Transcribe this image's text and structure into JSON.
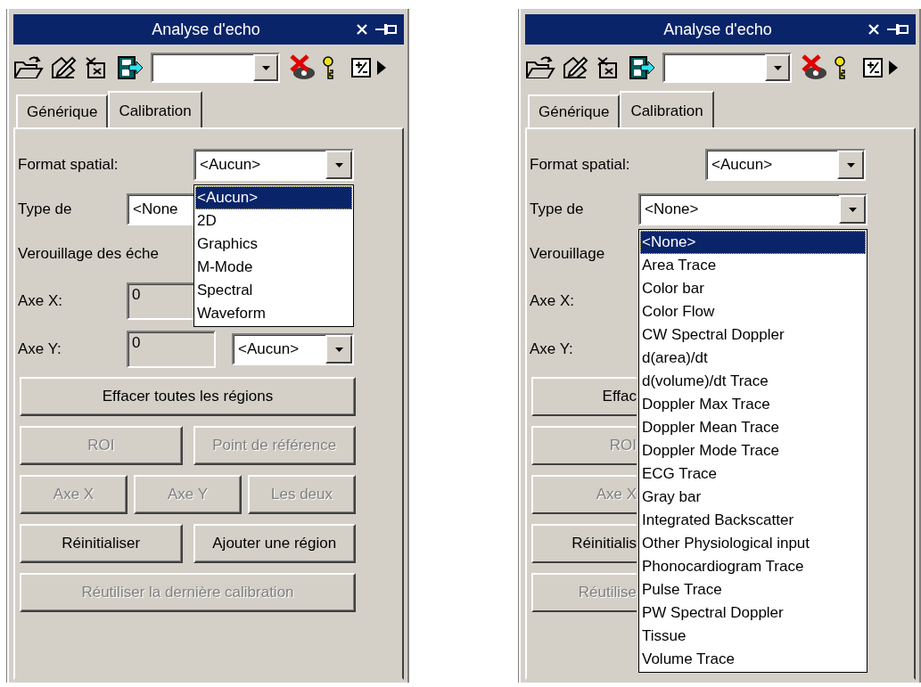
{
  "panels": [
    {
      "title": "Analyse d'echo",
      "tabs": [
        {
          "label": "Générique",
          "selected": false
        },
        {
          "label": "Calibration",
          "selected": true
        }
      ],
      "fields": [
        {
          "kind": "select",
          "label": "Format spatial:",
          "value": "<Aucun>",
          "dropdown": {
            "items": [
              {
                "label": "<Aucun>",
                "selected": true
              },
              {
                "label": "2D",
                "selected": false
              },
              {
                "label": "Graphics",
                "selected": false
              },
              {
                "label": "M-Mode",
                "selected": false
              },
              {
                "label": "Spectral",
                "selected": false
              },
              {
                "label": "Waveform",
                "selected": false
              }
            ]
          }
        },
        {
          "kind": "partial-select",
          "label": "Type de",
          "value": "<None"
        },
        {
          "kind": "label",
          "label": "Verouillage des éche"
        },
        {
          "kind": "axis",
          "label": "Axe X:",
          "input": "0"
        },
        {
          "kind": "axis",
          "label": "Axe Y:",
          "input": "0",
          "unit": "<Aucun>"
        }
      ],
      "button_rows": [
        {
          "buttons": [
            {
              "kind": "button",
              "label": "Effacer toutes les régions",
              "disabled": false
            }
          ]
        },
        {
          "buttons": [
            {
              "kind": "button",
              "label": "ROI",
              "disabled": true
            },
            {
              "kind": "button",
              "label": "Point de référence",
              "disabled": true
            }
          ]
        },
        {
          "buttons": [
            {
              "kind": "button",
              "label": "Axe X",
              "disabled": true
            },
            {
              "kind": "button",
              "label": "Axe Y",
              "disabled": true
            },
            {
              "kind": "button",
              "label": "Les deux",
              "disabled": true
            }
          ]
        },
        {
          "buttons": [
            {
              "kind": "button",
              "label": "Réinitialiser",
              "disabled": false
            },
            {
              "kind": "button",
              "label": "Ajouter une région",
              "disabled": false
            }
          ]
        },
        {
          "buttons": [
            {
              "kind": "button",
              "label": "Réutiliser la dernière calibration",
              "disabled": true
            }
          ]
        }
      ]
    },
    {
      "title": "Analyse d'echo",
      "tabs": [
        {
          "label": "Générique",
          "selected": false
        },
        {
          "label": "Calibration",
          "selected": true
        }
      ],
      "fields": [
        {
          "kind": "select",
          "label": "Format spatial:",
          "value": "<Aucun>"
        },
        {
          "kind": "select",
          "label": "Type de",
          "value": "<None>",
          "dropdown": {
            "items": [
              {
                "label": "<None>",
                "selected": true
              },
              {
                "label": "Area Trace",
                "selected": false
              },
              {
                "label": "Color bar",
                "selected": false
              },
              {
                "label": "Color Flow",
                "selected": false
              },
              {
                "label": "CW Spectral Doppler",
                "selected": false
              },
              {
                "label": "d(area)/dt",
                "selected": false
              },
              {
                "label": "d(volume)/dt Trace",
                "selected": false
              },
              {
                "label": "Doppler Max Trace",
                "selected": false
              },
              {
                "label": "Doppler Mean Trace",
                "selected": false
              },
              {
                "label": "Doppler Mode Trace",
                "selected": false
              },
              {
                "label": "ECG Trace",
                "selected": false
              },
              {
                "label": "Gray bar",
                "selected": false
              },
              {
                "label": "Integrated Backscatter",
                "selected": false
              },
              {
                "label": "Other Physiological input",
                "selected": false
              },
              {
                "label": "Phonocardiogram Trace",
                "selected": false
              },
              {
                "label": "Pulse Trace",
                "selected": false
              },
              {
                "label": "PW Spectral Doppler",
                "selected": false
              },
              {
                "label": "Tissue",
                "selected": false
              },
              {
                "label": "Volume Trace",
                "selected": false
              }
            ]
          }
        },
        {
          "kind": "label",
          "label": "Verouillage"
        },
        {
          "kind": "axis",
          "label": "Axe X:"
        },
        {
          "kind": "axis",
          "label": "Axe Y:"
        }
      ],
      "button_rows": [
        {
          "buttons": [
            {
              "kind": "partial-button",
              "label": "Effac",
              "disabled": false
            }
          ]
        },
        {
          "buttons": [
            {
              "kind": "partial-button",
              "label": "ROI",
              "disabled": true
            }
          ]
        },
        {
          "buttons": [
            {
              "kind": "partial-button",
              "label": "Axe X",
              "disabled": true
            }
          ]
        },
        {
          "buttons": [
            {
              "kind": "partial-button",
              "label": "Réinitialis",
              "disabled": false
            }
          ]
        },
        {
          "buttons": [
            {
              "kind": "partial-button",
              "label": "Réutilise",
              "disabled": true
            }
          ]
        }
      ]
    }
  ]
}
